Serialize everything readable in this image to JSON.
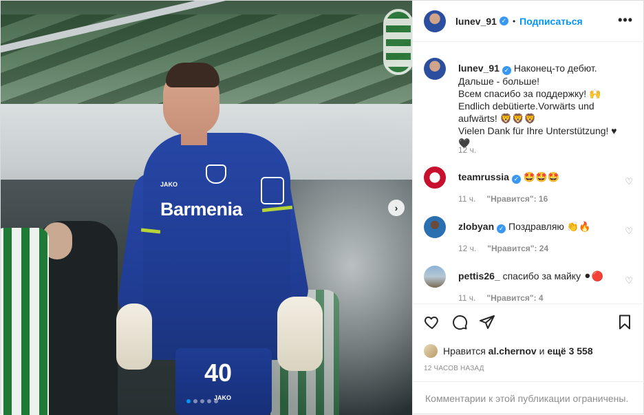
{
  "post": {
    "username": "lunev_91",
    "follow_label": "Подписаться",
    "separator": "•",
    "more_label": "•••",
    "caption_lines": [
      "Наконец-то дебют. Дальше - больше!",
      "Всем спасибо за поддержку! 🙌",
      "Endlich debütierte.Vorwärts und aufwärts! 🦁🦁🦁",
      "Vielen Dank für Ihre Unterstützung! ♥🖤"
    ],
    "caption_time": "12 ч."
  },
  "media": {
    "sponsor": "Barmenia",
    "kit_brand": "JAKO",
    "shirt_number": "40",
    "next_label": "›",
    "slide_count": 5,
    "active_slide": 1
  },
  "comments": [
    {
      "username": "teamrussia",
      "text": "🤩🤩🤩",
      "time": "11 ч.",
      "likes": "\"Нравится\": 16",
      "verified": true
    },
    {
      "username": "zlobyan",
      "text": "Поздравляю 👏🔥",
      "time": "12 ч.",
      "likes": "\"Нравится\": 24",
      "verified": true
    },
    {
      "username": "pettis26_",
      "text": "спасибо за майку ⚫🔴",
      "time": "11 ч.",
      "likes": "\"Нравится\": 4",
      "verified": false
    }
  ],
  "actions": {
    "likes_prefix": "Нравится",
    "likes_user": "al.chernov",
    "likes_middle": "и",
    "likes_rest": "ещё 3 558",
    "timestamp": "12 ЧАСОВ НАЗАД",
    "comments_closed": "Комментарии к этой публикации ограничены."
  },
  "icons": {
    "like": "heart-icon",
    "comment": "comment-icon",
    "share": "share-icon",
    "save": "bookmark-icon",
    "verified": "verified-icon"
  },
  "colors": {
    "link": "#0095f6",
    "verified": "#3897f0",
    "muted": "#8e8e8e",
    "text": "#262626"
  }
}
